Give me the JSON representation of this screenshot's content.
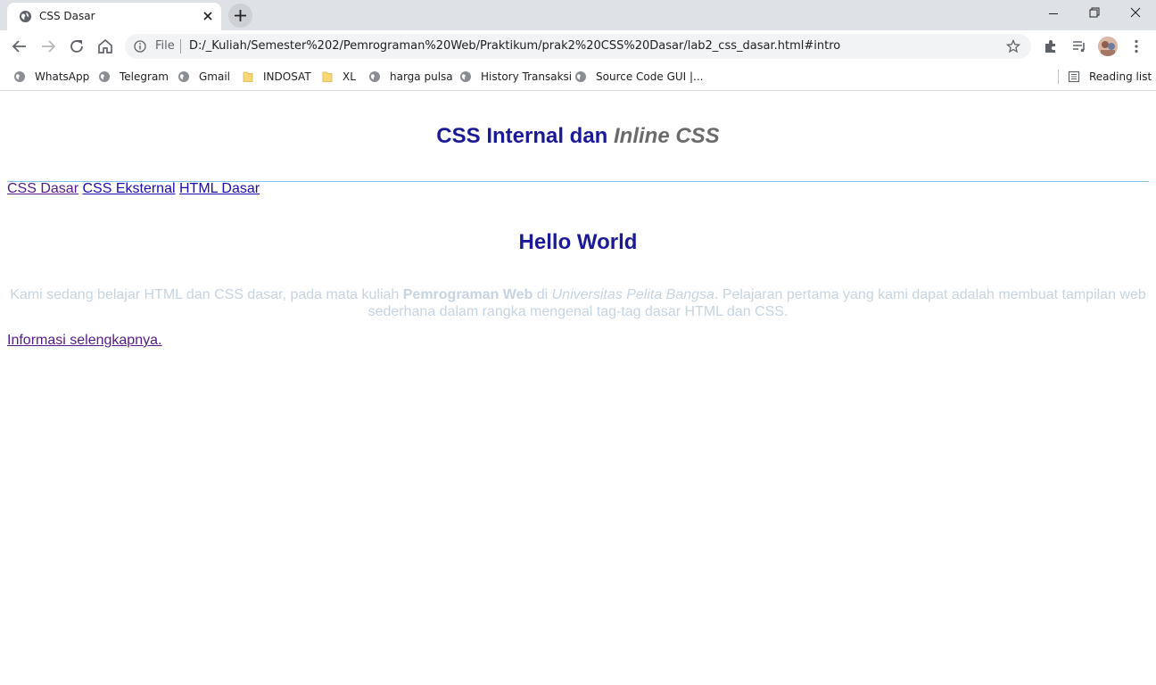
{
  "browser": {
    "tab": {
      "title": "CSS Dasar"
    },
    "address": {
      "scheme_label": "File",
      "url": "D:/_Kuliah/Semester%202/Pemrograman%20Web/Praktikum/prak2%20CSS%20Dasar/lab2_css_dasar.html#intro"
    },
    "bookmarks": [
      {
        "label": "WhatsApp",
        "icon": "globe-icon"
      },
      {
        "label": "Telegram",
        "icon": "globe-icon"
      },
      {
        "label": "Gmail",
        "icon": "globe-icon"
      },
      {
        "label": "INDOSAT",
        "icon": "folder-icon"
      },
      {
        "label": "XL",
        "icon": "folder-icon"
      },
      {
        "label": "harga pulsa",
        "icon": "globe-icon"
      },
      {
        "label": "History Transaksi",
        "icon": "globe-icon"
      },
      {
        "label": "Source Code GUI |...",
        "icon": "globe-icon"
      }
    ],
    "reading_list": "Reading list"
  },
  "page": {
    "title_part1": "CSS Internal dan ",
    "title_part2": "Inline CSS",
    "nav_links": [
      "CSS Dasar",
      "CSS Eksternal",
      "HTML Dasar"
    ],
    "heading": "Hello World",
    "paragraph": {
      "t1": "Kami sedang belajar HTML dan CSS dasar, pada mata kuliah ",
      "bold": "Pemrograman Web",
      "t2": " di ",
      "italic": "Universitas Pelita Bangsa",
      "t3": ". Pelajaran pertama yang kami dapat adalah membuat tampilan web sederhana dalam rangka mengenal tag-tag dasar HTML dan CSS."
    },
    "more_link": "Informasi selengkapnya."
  },
  "colors": {
    "heading": "#1a1a96",
    "italic_title": "#6b6b6b",
    "paragraph": "#c6d4e2",
    "rule": "#7fc4e8",
    "link": "#1a0dab",
    "visited_link": "#551a8b"
  }
}
